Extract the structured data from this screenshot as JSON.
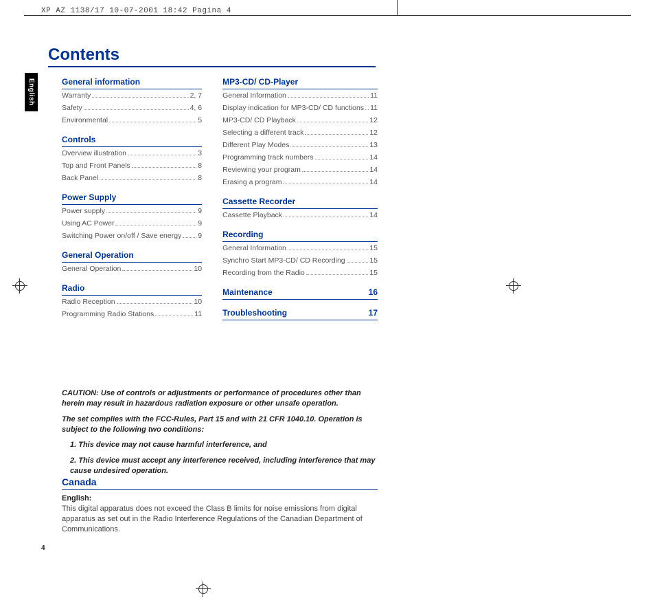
{
  "meta": {
    "printHeader": "XP AZ 1138/17  10-07-2001 18:42  Pagina 4",
    "languageTab": "English",
    "pageTitle": "Contents",
    "pageNumber": "4"
  },
  "columnLeft": [
    {
      "type": "head",
      "label": "General information"
    },
    {
      "type": "row",
      "label": "Warranty",
      "page": "2, 7"
    },
    {
      "type": "row",
      "label": "Safety",
      "page": "4, 6"
    },
    {
      "type": "row",
      "label": "Environmental",
      "page": "5"
    },
    {
      "type": "head",
      "label": "Controls"
    },
    {
      "type": "row",
      "label": "Overview illustration",
      "page": "3"
    },
    {
      "type": "row",
      "label": "Top and Front Panels",
      "page": "8"
    },
    {
      "type": "row",
      "label": "Back Panel",
      "page": "8"
    },
    {
      "type": "head",
      "label": "Power Supply"
    },
    {
      "type": "row",
      "label": "Power supply",
      "page": "9"
    },
    {
      "type": "row",
      "label": "Using AC Power",
      "page": "9"
    },
    {
      "type": "row",
      "label": "Switching Power on/off / Save energy",
      "page": "9"
    },
    {
      "type": "head",
      "label": "General Operation"
    },
    {
      "type": "row",
      "label": "General Operation",
      "page": "10"
    },
    {
      "type": "head",
      "label": "Radio"
    },
    {
      "type": "row",
      "label": "Radio Reception",
      "page": "10"
    },
    {
      "type": "row",
      "label": "Programming Radio Stations",
      "page": "11"
    }
  ],
  "columnRight": [
    {
      "type": "head",
      "label": "MP3-CD/ CD-Player"
    },
    {
      "type": "row",
      "label": "General Information",
      "page": "11"
    },
    {
      "type": "row",
      "label": "Display indication for MP3-CD/ CD functions",
      "page": "11"
    },
    {
      "type": "row",
      "label": "MP3-CD/ CD Playback",
      "page": "12"
    },
    {
      "type": "row",
      "label": "Selecting a different track",
      "page": "12"
    },
    {
      "type": "row",
      "label": "Different Play Modes",
      "page": "13"
    },
    {
      "type": "row",
      "label": "Programming track numbers",
      "page": "14"
    },
    {
      "type": "row",
      "label": "Reviewing your program",
      "page": "14"
    },
    {
      "type": "row",
      "label": "Erasing a program",
      "page": "14"
    },
    {
      "type": "head",
      "label": "Cassette Recorder"
    },
    {
      "type": "row",
      "label": "Cassette Playback",
      "page": "14"
    },
    {
      "type": "head",
      "label": "Recording"
    },
    {
      "type": "row",
      "label": "General Information",
      "page": "15"
    },
    {
      "type": "row",
      "label": "Synchro Start MP3-CD/ CD Recording",
      "page": "15"
    },
    {
      "type": "row",
      "label": "Recording from the Radio",
      "page": "15"
    },
    {
      "type": "headpage",
      "label": "Maintenance",
      "page": "16"
    },
    {
      "type": "headpage",
      "label": "Troubleshooting",
      "page": "17"
    }
  ],
  "caution": {
    "p1": "CAUTION: Use of controls or adjustments or performance of procedures other than herein may result in hazardous radiation exposure or other unsafe operation.",
    "p2": "The set complies with the FCC-Rules, Part 15 and with 21 CFR 1040.10. Operation is subject to the following two conditions:",
    "l1": "1.  This device may not cause harmful interference, and",
    "l2": "2.  This device must accept any interference received, including interference that may cause undesired operation."
  },
  "canada": {
    "heading": "Canada",
    "englishLabel": "English:",
    "body": "This digital apparatus does not exceed the Class B limits for noise emissions from digital apparatus as set out in the Radio Interference Regulations of the Canadian Department of Communications."
  }
}
